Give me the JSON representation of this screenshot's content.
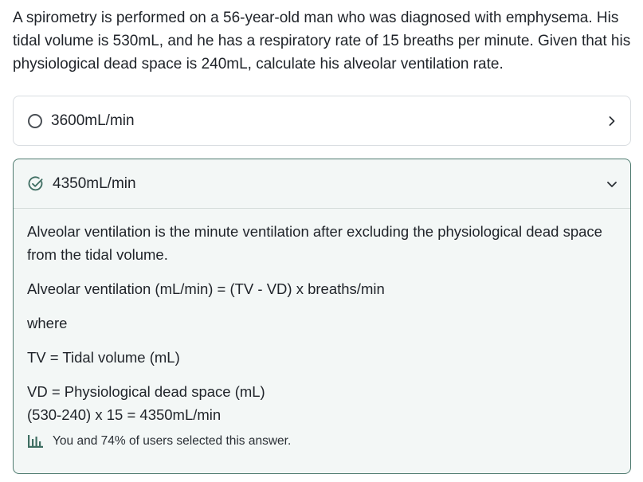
{
  "question": {
    "text": "A spirometry is performed on a 56-year-old man who was diagnosed with emphysema. His tidal volume is 530mL, and he has a respiratory rate of 15 breaths per minute. Given that his physiological dead space is 240mL, calculate his alveolar ventilation rate."
  },
  "options": [
    {
      "label": "3600mL/min",
      "state": "unselected",
      "icon": "chevron-right-icon"
    },
    {
      "label": "4350mL/min",
      "state": "selected-correct",
      "icon": "chevron-down-icon"
    }
  ],
  "explanation": {
    "p1": "Alveolar ventilation is the minute ventilation after excluding the physiological dead space from the tidal volume.",
    "p2": "Alveolar ventilation (mL/min) = (TV - VD) x breaths/min",
    "p3": "where",
    "p4": "TV = Tidal volume (mL)",
    "p5": "VD = Physiological dead space (mL)",
    "p6": "(530-240) x 15 = 4350mL/min"
  },
  "stats": {
    "text": "You and 74% of users selected this answer.",
    "icon": "bar-chart-icon"
  },
  "colors": {
    "correct_border": "#4e7a6f",
    "correct_bg": "#f3f7f6",
    "check": "#3f6e62"
  }
}
